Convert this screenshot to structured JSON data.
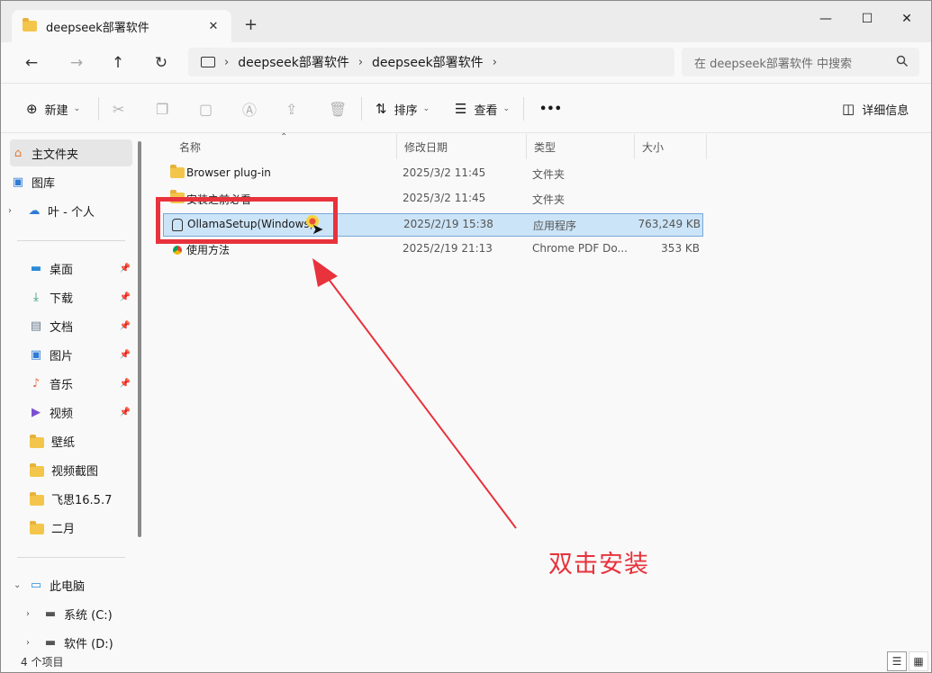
{
  "window": {
    "tab_title": "deepseek部署软件",
    "tab_close": "✕",
    "new_tab": "+",
    "minimize": "—",
    "maximize": "☐",
    "close": "✕"
  },
  "nav": {
    "back": "←",
    "forward": "→",
    "up": "↑",
    "refresh": "↻",
    "breadcrumbs": [
      "deepseek部署软件",
      "deepseek部署软件"
    ],
    "chevron": "›",
    "search_placeholder": "在 deepseek部署软件 中搜索"
  },
  "toolbar": {
    "new_label": "新建",
    "sort_label": "排序",
    "view_label": "查看",
    "more_label": "•••",
    "details_label": "详细信息"
  },
  "sidebar": {
    "items": [
      {
        "label": "主文件夹",
        "icon": "home-icon"
      },
      {
        "label": "图库",
        "icon": "gallery-icon"
      },
      {
        "label": "叶 - 个人",
        "icon": "cloud-icon"
      },
      {
        "label": "桌面",
        "icon": "desktop-icon"
      },
      {
        "label": "下载",
        "icon": "download-icon"
      },
      {
        "label": "文档",
        "icon": "document-icon"
      },
      {
        "label": "图片",
        "icon": "pictures-icon"
      },
      {
        "label": "音乐",
        "icon": "music-icon"
      },
      {
        "label": "视频",
        "icon": "video-icon"
      },
      {
        "label": "壁纸",
        "icon": "folder-icon"
      },
      {
        "label": "视频截图",
        "icon": "folder-icon"
      },
      {
        "label": "飞思16.5.7",
        "icon": "folder-icon"
      },
      {
        "label": "二月",
        "icon": "folder-icon"
      },
      {
        "label": "此电脑",
        "icon": "computer-icon"
      },
      {
        "label": "系统 (C:)",
        "icon": "drive-icon"
      },
      {
        "label": "软件 (D:)",
        "icon": "drive-icon"
      }
    ]
  },
  "columns": {
    "name": "名称",
    "date": "修改日期",
    "type": "类型",
    "size": "大小"
  },
  "files": [
    {
      "name": "Browser plug-in",
      "date": "2025/3/2 11:45",
      "type": "文件夹",
      "size": "",
      "icon": "folder-icon"
    },
    {
      "name": "安装之前必看",
      "date": "2025/3/2 11:45",
      "type": "文件夹",
      "size": "",
      "icon": "folder-icon"
    },
    {
      "name": "OllamaSetup(Windows)",
      "date": "2025/2/19 15:38",
      "type": "应用程序",
      "size": "763,249 KB",
      "icon": "ollama-icon"
    },
    {
      "name": "使用方法",
      "date": "2025/2/19 21:13",
      "type": "Chrome PDF Do...",
      "size": "353 KB",
      "icon": "chrome-pdf-icon"
    }
  ],
  "annotation": {
    "text": "双击安装",
    "color": "#e8323c"
  },
  "status": {
    "count": "4 个项目"
  }
}
